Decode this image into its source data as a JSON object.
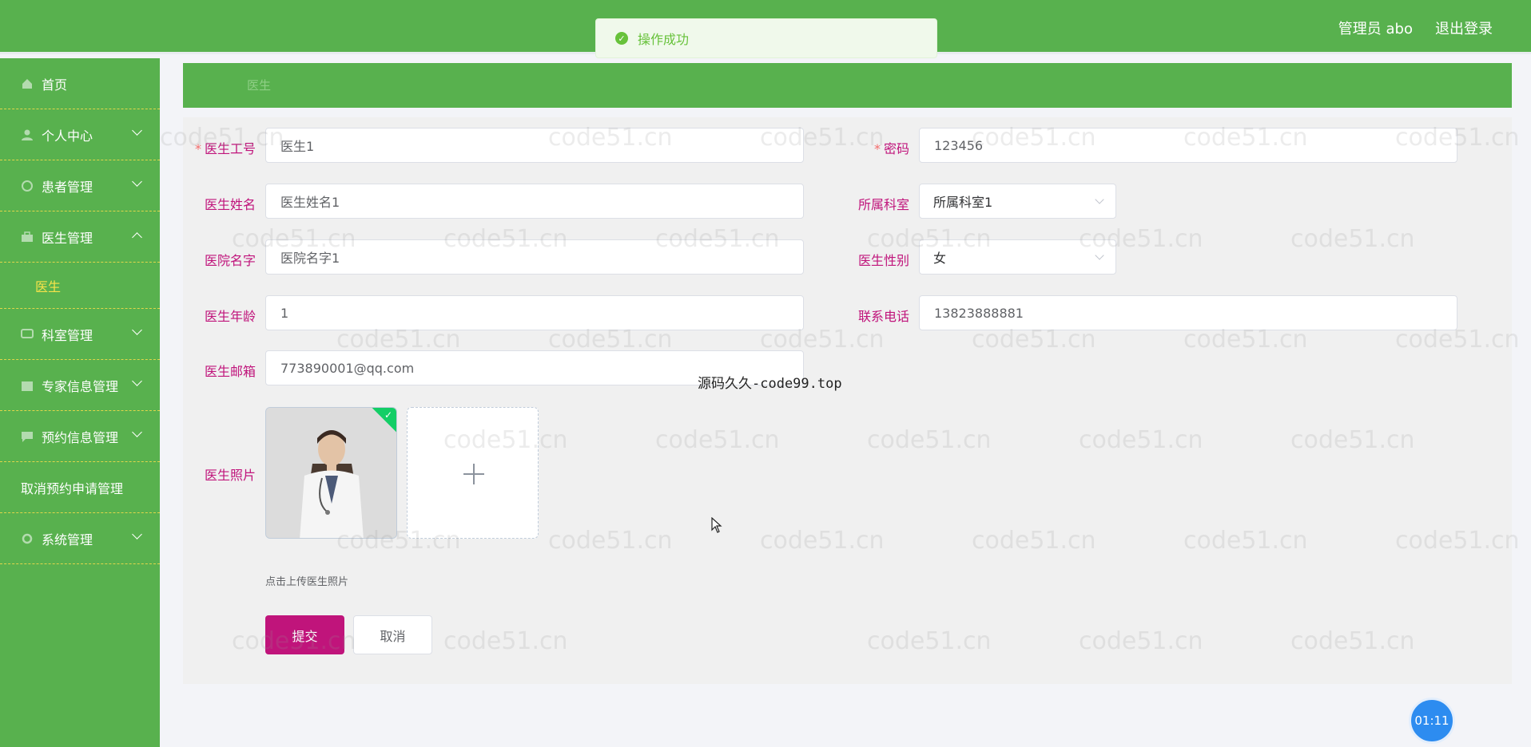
{
  "header": {
    "user_label": "管理员 abo",
    "logout_label": "退出登录"
  },
  "toast": {
    "message": "操作成功"
  },
  "sidebar": {
    "items": [
      {
        "label": "首页"
      },
      {
        "label": "个人中心"
      },
      {
        "label": "患者管理"
      },
      {
        "label": "医生管理"
      },
      {
        "label": "科室管理"
      },
      {
        "label": "专家信息管理"
      },
      {
        "label": "预约信息管理"
      },
      {
        "label": "取消预约申请管理"
      },
      {
        "label": "系统管理"
      }
    ],
    "sub_item": {
      "label": "医生"
    }
  },
  "breadcrumb": {
    "label": "医生"
  },
  "form": {
    "doctor_id": {
      "label": "医生工号",
      "value": "医生1"
    },
    "password": {
      "label": "密码",
      "value": "123456"
    },
    "doctor_name": {
      "label": "医生姓名",
      "value": "医生姓名1"
    },
    "department": {
      "label": "所属科室",
      "value": "所属科室1"
    },
    "hospital": {
      "label": "医院名字",
      "value": "医院名字1"
    },
    "gender": {
      "label": "医生性别",
      "value": "女"
    },
    "age": {
      "label": "医生年龄",
      "value": "1"
    },
    "phone": {
      "label": "联系电话",
      "value": "13823888881"
    },
    "email": {
      "label": "医生邮箱",
      "value": "773890001@qq.com"
    },
    "photo": {
      "label": "医生照片",
      "hint": "点击上传医生照片"
    },
    "required_mark": "*",
    "submit_label": "提交",
    "cancel_label": "取消"
  },
  "overlay_text": "源码久久-code99.top",
  "timer": "01:11",
  "watermark": "code51.cn",
  "colors": {
    "primary_green": "#58b14e",
    "accent_magenta": "#c0147b",
    "submenu_yellow": "#f7e34a",
    "success": "#67c23a"
  }
}
